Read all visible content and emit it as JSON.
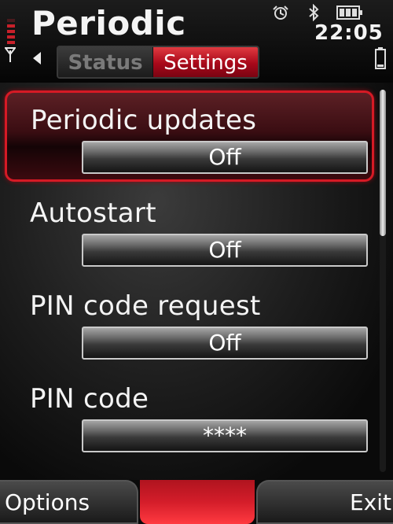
{
  "header": {
    "title": "Periodic",
    "clock": "22:05"
  },
  "tabs": [
    {
      "label": "Status",
      "selected": false
    },
    {
      "label": "Settings",
      "selected": true
    }
  ],
  "settings": {
    "items": [
      {
        "label": "Periodic updates",
        "value": "Off",
        "selected": true
      },
      {
        "label": "Autostart",
        "value": "Off",
        "selected": false
      },
      {
        "label": "PIN code request",
        "value": "Off",
        "selected": false
      },
      {
        "label": "PIN code",
        "value": "****",
        "selected": false
      }
    ]
  },
  "softkeys": {
    "left": "Options",
    "right": "Exit"
  },
  "colors": {
    "accent": "#d51a25",
    "background": "#0b0b0b",
    "text": "#ffffff"
  },
  "icons": [
    "signal-strength-icon",
    "antenna-icon",
    "alarm-icon",
    "bluetooth-icon",
    "battery-icon",
    "tab-left-arrow-icon"
  ]
}
